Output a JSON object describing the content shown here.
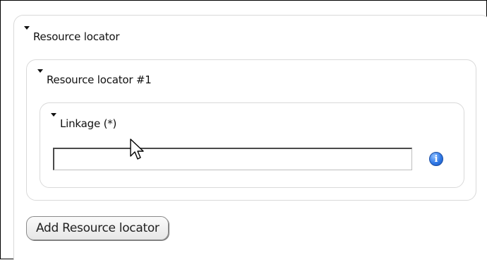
{
  "sections": {
    "outer": {
      "label": "Resource locator"
    },
    "item": {
      "label": "Resource locator #1"
    },
    "linkage": {
      "label": "Linkage (*)",
      "value": "",
      "placeholder": ""
    }
  },
  "info_icon": {
    "glyph": "i",
    "icon": "info-icon",
    "color": "#2f78e6"
  },
  "add_button": {
    "label": "Add Resource locator"
  }
}
